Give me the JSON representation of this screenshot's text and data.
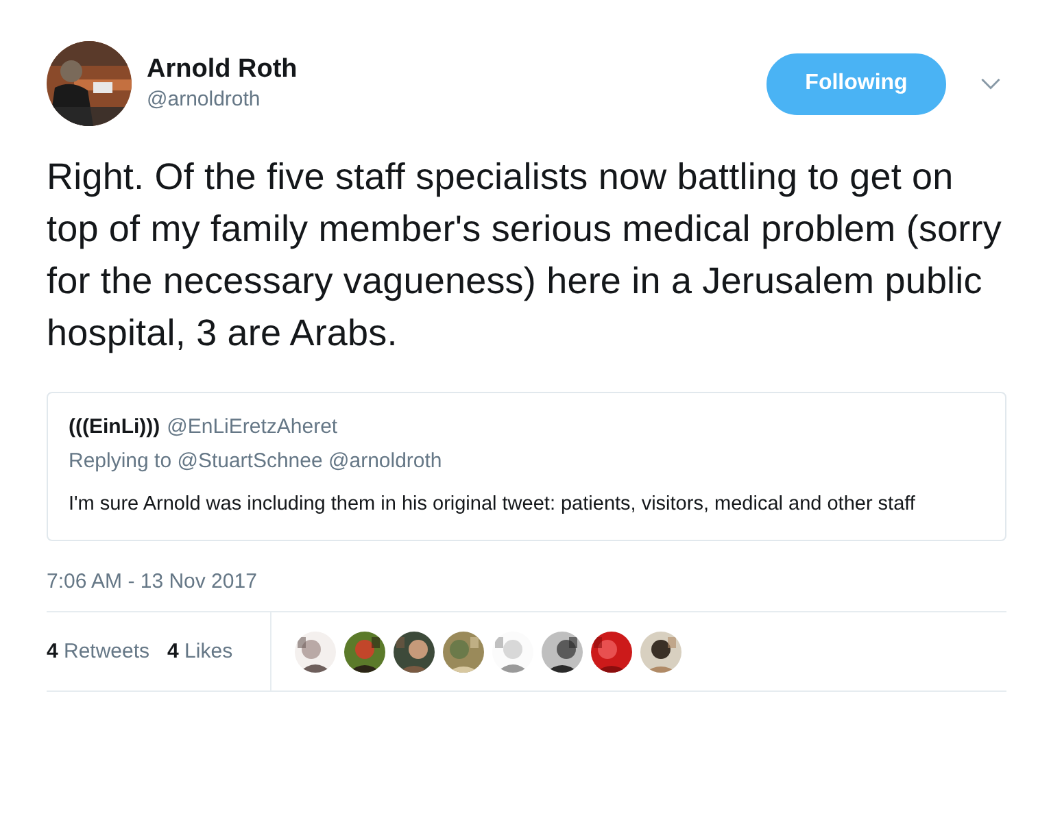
{
  "author": {
    "name": "Arnold Roth",
    "handle": "@arnoldroth"
  },
  "follow_button": {
    "label": "Following",
    "selected": true
  },
  "tweet_text": "Right. Of the five staff specialists now battling to get on top of my family member's serious medical problem (sorry for the necessary vagueness) here in a Jerusalem public hospital, 3 are Arabs.",
  "quoted_tweet": {
    "name": "(((EinLi)))",
    "handle": "@EnLiEretzAheret",
    "replying_to": "Replying to @StuartSchnee @arnoldroth",
    "text": "I'm sure Arnold was including them in his original tweet: patients, visitors, medical and other staff"
  },
  "timestamp": "7:06 AM - 13 Nov 2017",
  "stats": [
    {
      "count": "4",
      "label": "Retweets"
    },
    {
      "count": "4",
      "label": "Likes"
    }
  ]
}
